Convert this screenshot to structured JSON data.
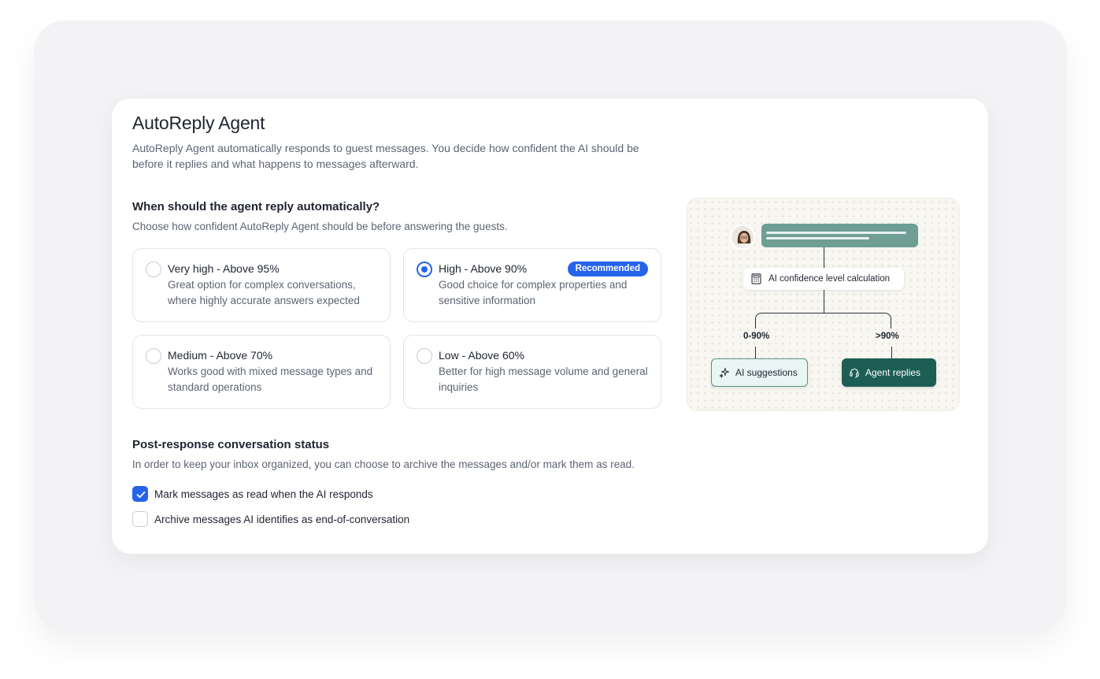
{
  "header": {
    "title": "AutoReply Agent",
    "description": "AutoReply Agent automatically responds to guest messages. You decide how confident the AI should be before it replies and what happens to messages afterward."
  },
  "confidence": {
    "title": "When should the agent reply automatically?",
    "subtitle": "Choose how confident AutoReply Agent should be before answering the guests.",
    "options": [
      {
        "label": "Very high - Above 95%",
        "description": "Great option for complex conversations, where highly accurate answers expected",
        "selected": false
      },
      {
        "label": "High - Above 90%",
        "description": "Good choice for complex properties and sensitive information",
        "selected": true,
        "badge": "Recommended"
      },
      {
        "label": "Medium - Above 70%",
        "description": "Works good with mixed message types and standard operations",
        "selected": false
      },
      {
        "label": "Low - Above 60%",
        "description": "Better for high message volume and general inquiries",
        "selected": false
      }
    ]
  },
  "post_response": {
    "title": "Post-response conversation status",
    "subtitle": "In order to keep your inbox organized, you can choose to archive the messages and/or mark them as read.",
    "checkboxes": [
      {
        "label": "Mark messages as read when the AI responds",
        "checked": true
      },
      {
        "label": "Archive messages AI identifies as end-of-conversation",
        "checked": false
      }
    ]
  },
  "diagram": {
    "calc_label": "AI confidence level calculation",
    "low_range": "0-90%",
    "high_range": ">90%",
    "low_outcome": "AI suggestions",
    "high_outcome": "Agent replies",
    "icons": [
      "avatar",
      "calculator-icon",
      "sparkles-icon",
      "headset-icon"
    ]
  },
  "colors": {
    "accent": "#2563eb",
    "teal_dark": "#1c5e56",
    "teal_light": "#e9f6f4",
    "message_bar": "#6e9e94"
  }
}
